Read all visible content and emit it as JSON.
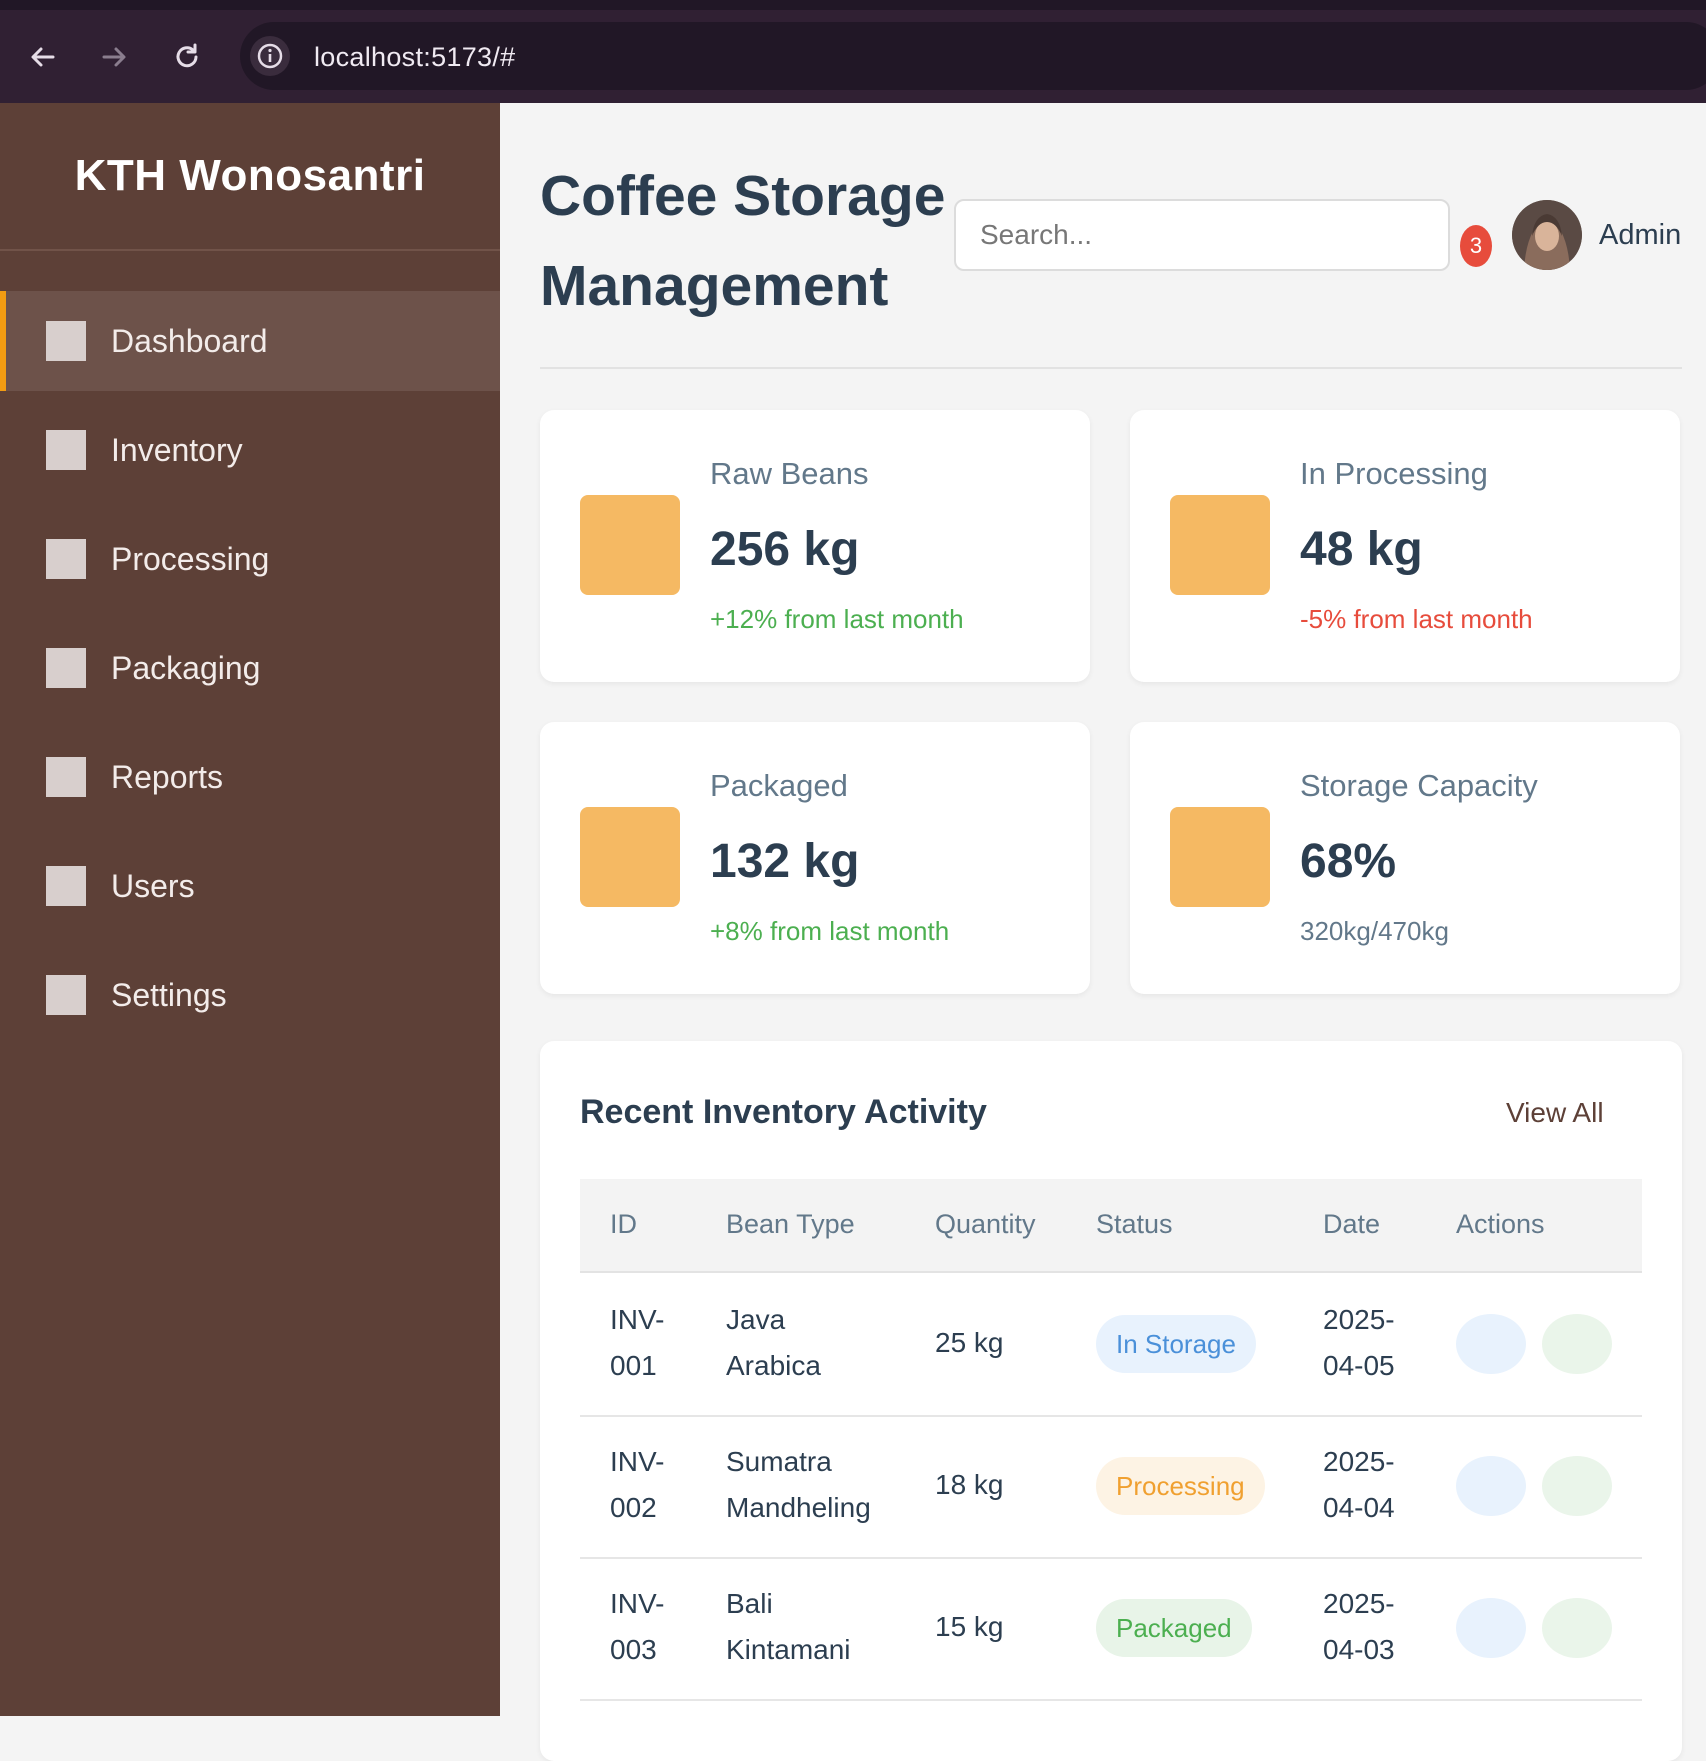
{
  "browser": {
    "url": "localhost:5173/#"
  },
  "sidebar": {
    "brand": "KTH Wonosantri",
    "items": [
      {
        "label": "Dashboard",
        "active": true
      },
      {
        "label": "Inventory"
      },
      {
        "label": "Processing"
      },
      {
        "label": "Packaging"
      },
      {
        "label": "Reports"
      },
      {
        "label": "Users"
      },
      {
        "label": "Settings"
      }
    ]
  },
  "header": {
    "title": "Coffee Storage Management",
    "search_placeholder": "Search...",
    "notification_count": "3",
    "user_name": "Admin"
  },
  "stats": [
    {
      "label": "Raw Beans",
      "value": "256 kg",
      "sub": "+12% from last month",
      "trend": "up"
    },
    {
      "label": "In Processing",
      "value": "48 kg",
      "sub": "-5% from last month",
      "trend": "down"
    },
    {
      "label": "Packaged",
      "value": "132 kg",
      "sub": "+8% from last month",
      "trend": "up"
    },
    {
      "label": "Storage Capacity",
      "value": "68%",
      "sub": "320kg/470kg",
      "trend": "neutral"
    }
  ],
  "activity": {
    "title": "Recent Inventory Activity",
    "view_all": "View All",
    "columns": [
      "ID",
      "Bean Type",
      "Quantity",
      "Status",
      "Date",
      "Actions"
    ],
    "rows": [
      {
        "id_a": "INV-",
        "id_b": "001",
        "bean_a": "Java",
        "bean_b": "Arabica",
        "qty": "25 kg",
        "status": "In Storage",
        "date_a": "2025-",
        "date_b": "04-05"
      },
      {
        "id_a": "INV-",
        "id_b": "002",
        "bean_a": "Sumatra",
        "bean_b": "Mandheling",
        "qty": "18 kg",
        "status": "Processing",
        "date_a": "2025-",
        "date_b": "04-04"
      },
      {
        "id_a": "INV-",
        "id_b": "003",
        "bean_a": "Bali",
        "bean_b": "Kintamani",
        "qty": "15 kg",
        "status": "Packaged",
        "date_a": "2025-",
        "date_b": "04-03"
      }
    ]
  },
  "colors": {
    "sidebar_bg": "#5d4037",
    "accent": "#f39c12",
    "card_icon": "#f5b963",
    "positive": "#4caf50",
    "negative": "#e74c3c"
  }
}
